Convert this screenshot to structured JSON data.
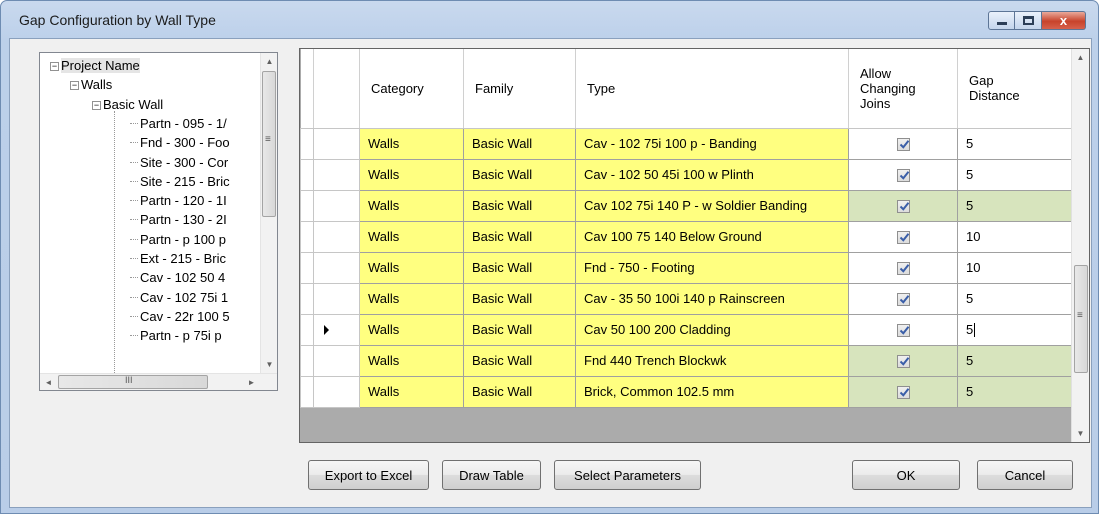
{
  "window": {
    "title": "Gap Configuration by Wall Type",
    "controls": {
      "minimize": "",
      "maximize": "",
      "close": "x"
    }
  },
  "tree": {
    "nodes": [
      {
        "label": "Project Name",
        "level": 0,
        "expander": "−"
      },
      {
        "label": "Walls",
        "level": 1,
        "expander": "−"
      },
      {
        "label": "Basic Wall",
        "level": 2,
        "expander": "−"
      },
      {
        "label": "Partn - 095 - 1/",
        "level": 3
      },
      {
        "label": "Fnd - 300 - Foo",
        "level": 3
      },
      {
        "label": "Site - 300 - Cor",
        "level": 3
      },
      {
        "label": "Site - 215 - Bric",
        "level": 3
      },
      {
        "label": "Partn - 120 - 1I",
        "level": 3
      },
      {
        "label": "Partn - 130 - 2I",
        "level": 3
      },
      {
        "label": "Partn - p 100 p",
        "level": 3
      },
      {
        "label": "Ext - 215 - Bric",
        "level": 3
      },
      {
        "label": "Cav - 102 50 4",
        "level": 3
      },
      {
        "label": "Cav - 102 75i 1",
        "level": 3
      },
      {
        "label": "Cav - 22r 100 5",
        "level": 3
      },
      {
        "label": "Partn - p 75i p",
        "level": 3
      }
    ],
    "scroll": {
      "up": "▲",
      "down": "▼",
      "left": "◄",
      "right": "►",
      "grip": "≡",
      "hgrip": "III"
    }
  },
  "grid": {
    "columns": {
      "category": "Category",
      "family": "Family",
      "type": "Type",
      "allow_joins": "Allow Changing Joins",
      "gap": "Gap Distance"
    },
    "rows": [
      {
        "category": "Walls",
        "family": "Basic Wall",
        "type": "Cav - 102 75i 100 p - Banding",
        "allow": true,
        "gap": "5",
        "highlight": false,
        "current": false
      },
      {
        "category": "Walls",
        "family": "Basic Wall",
        "type": "Cav - 102 50 45i 100 w Plinth",
        "allow": true,
        "gap": "5",
        "highlight": false,
        "current": false
      },
      {
        "category": "Walls",
        "family": "Basic Wall",
        "type": "Cav 102 75i 140 P - w Soldier Banding",
        "allow": true,
        "gap": "5",
        "highlight": true,
        "current": false
      },
      {
        "category": "Walls",
        "family": "Basic Wall",
        "type": "Cav 100 75 140 Below Ground",
        "allow": true,
        "gap": "10",
        "highlight": false,
        "current": false
      },
      {
        "category": "Walls",
        "family": "Basic Wall",
        "type": "Fnd - 750 - Footing",
        "allow": true,
        "gap": "10",
        "highlight": false,
        "current": false
      },
      {
        "category": "Walls",
        "family": "Basic Wall",
        "type": "Cav - 35 50 100i 140 p Rainscreen",
        "allow": true,
        "gap": "5",
        "highlight": false,
        "current": false
      },
      {
        "category": "Walls",
        "family": "Basic Wall",
        "type": "Cav 50 100 200 Cladding",
        "allow": true,
        "gap": "5",
        "highlight": false,
        "current": true
      },
      {
        "category": "Walls",
        "family": "Basic Wall",
        "type": "Fnd 440 Trench Blockwk",
        "allow": true,
        "gap": "5",
        "highlight": true,
        "current": false
      },
      {
        "category": "Walls",
        "family": "Basic Wall",
        "type": "Brick, Common 102.5 mm",
        "allow": true,
        "gap": "5",
        "highlight": true,
        "current": false
      }
    ],
    "scroll": {
      "up": "▲",
      "down": "▼",
      "grip": "≡"
    },
    "colors": {
      "yellow": "#ffff80",
      "green": "#d7e4bd"
    }
  },
  "buttons": {
    "export": "Export to Excel",
    "draw": "Draw Table",
    "select": "Select Parameters",
    "ok": "OK",
    "cancel": "Cancel"
  }
}
